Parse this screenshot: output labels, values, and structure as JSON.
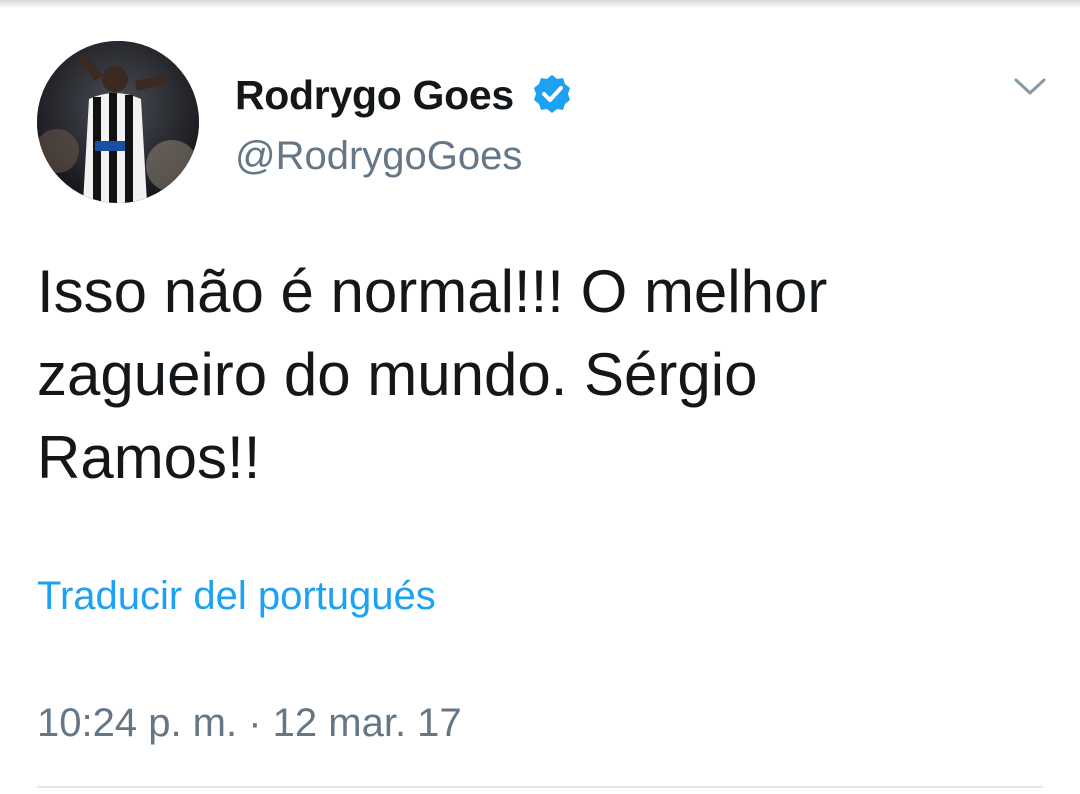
{
  "tweet": {
    "author": {
      "display_name": "Rodrygo Goes",
      "handle": "@RodrygoGoes",
      "verified": true,
      "avatar_icon": "profile-photo"
    },
    "text_lines": [
      "Isso não é normal!!! O melhor",
      "zagueiro do mundo. Sérgio",
      "Ramos!!"
    ],
    "translate_label": "Traducir del portugués",
    "timestamp": "10:24 p. m. · 12 mar. 17"
  },
  "colors": {
    "primary_text": "#14171a",
    "secondary_text": "#657786",
    "link_blue": "#1da1f2",
    "divider": "#e1e8ed"
  },
  "icons": {
    "verified": "verified-badge-icon",
    "menu": "chevron-down-icon"
  }
}
